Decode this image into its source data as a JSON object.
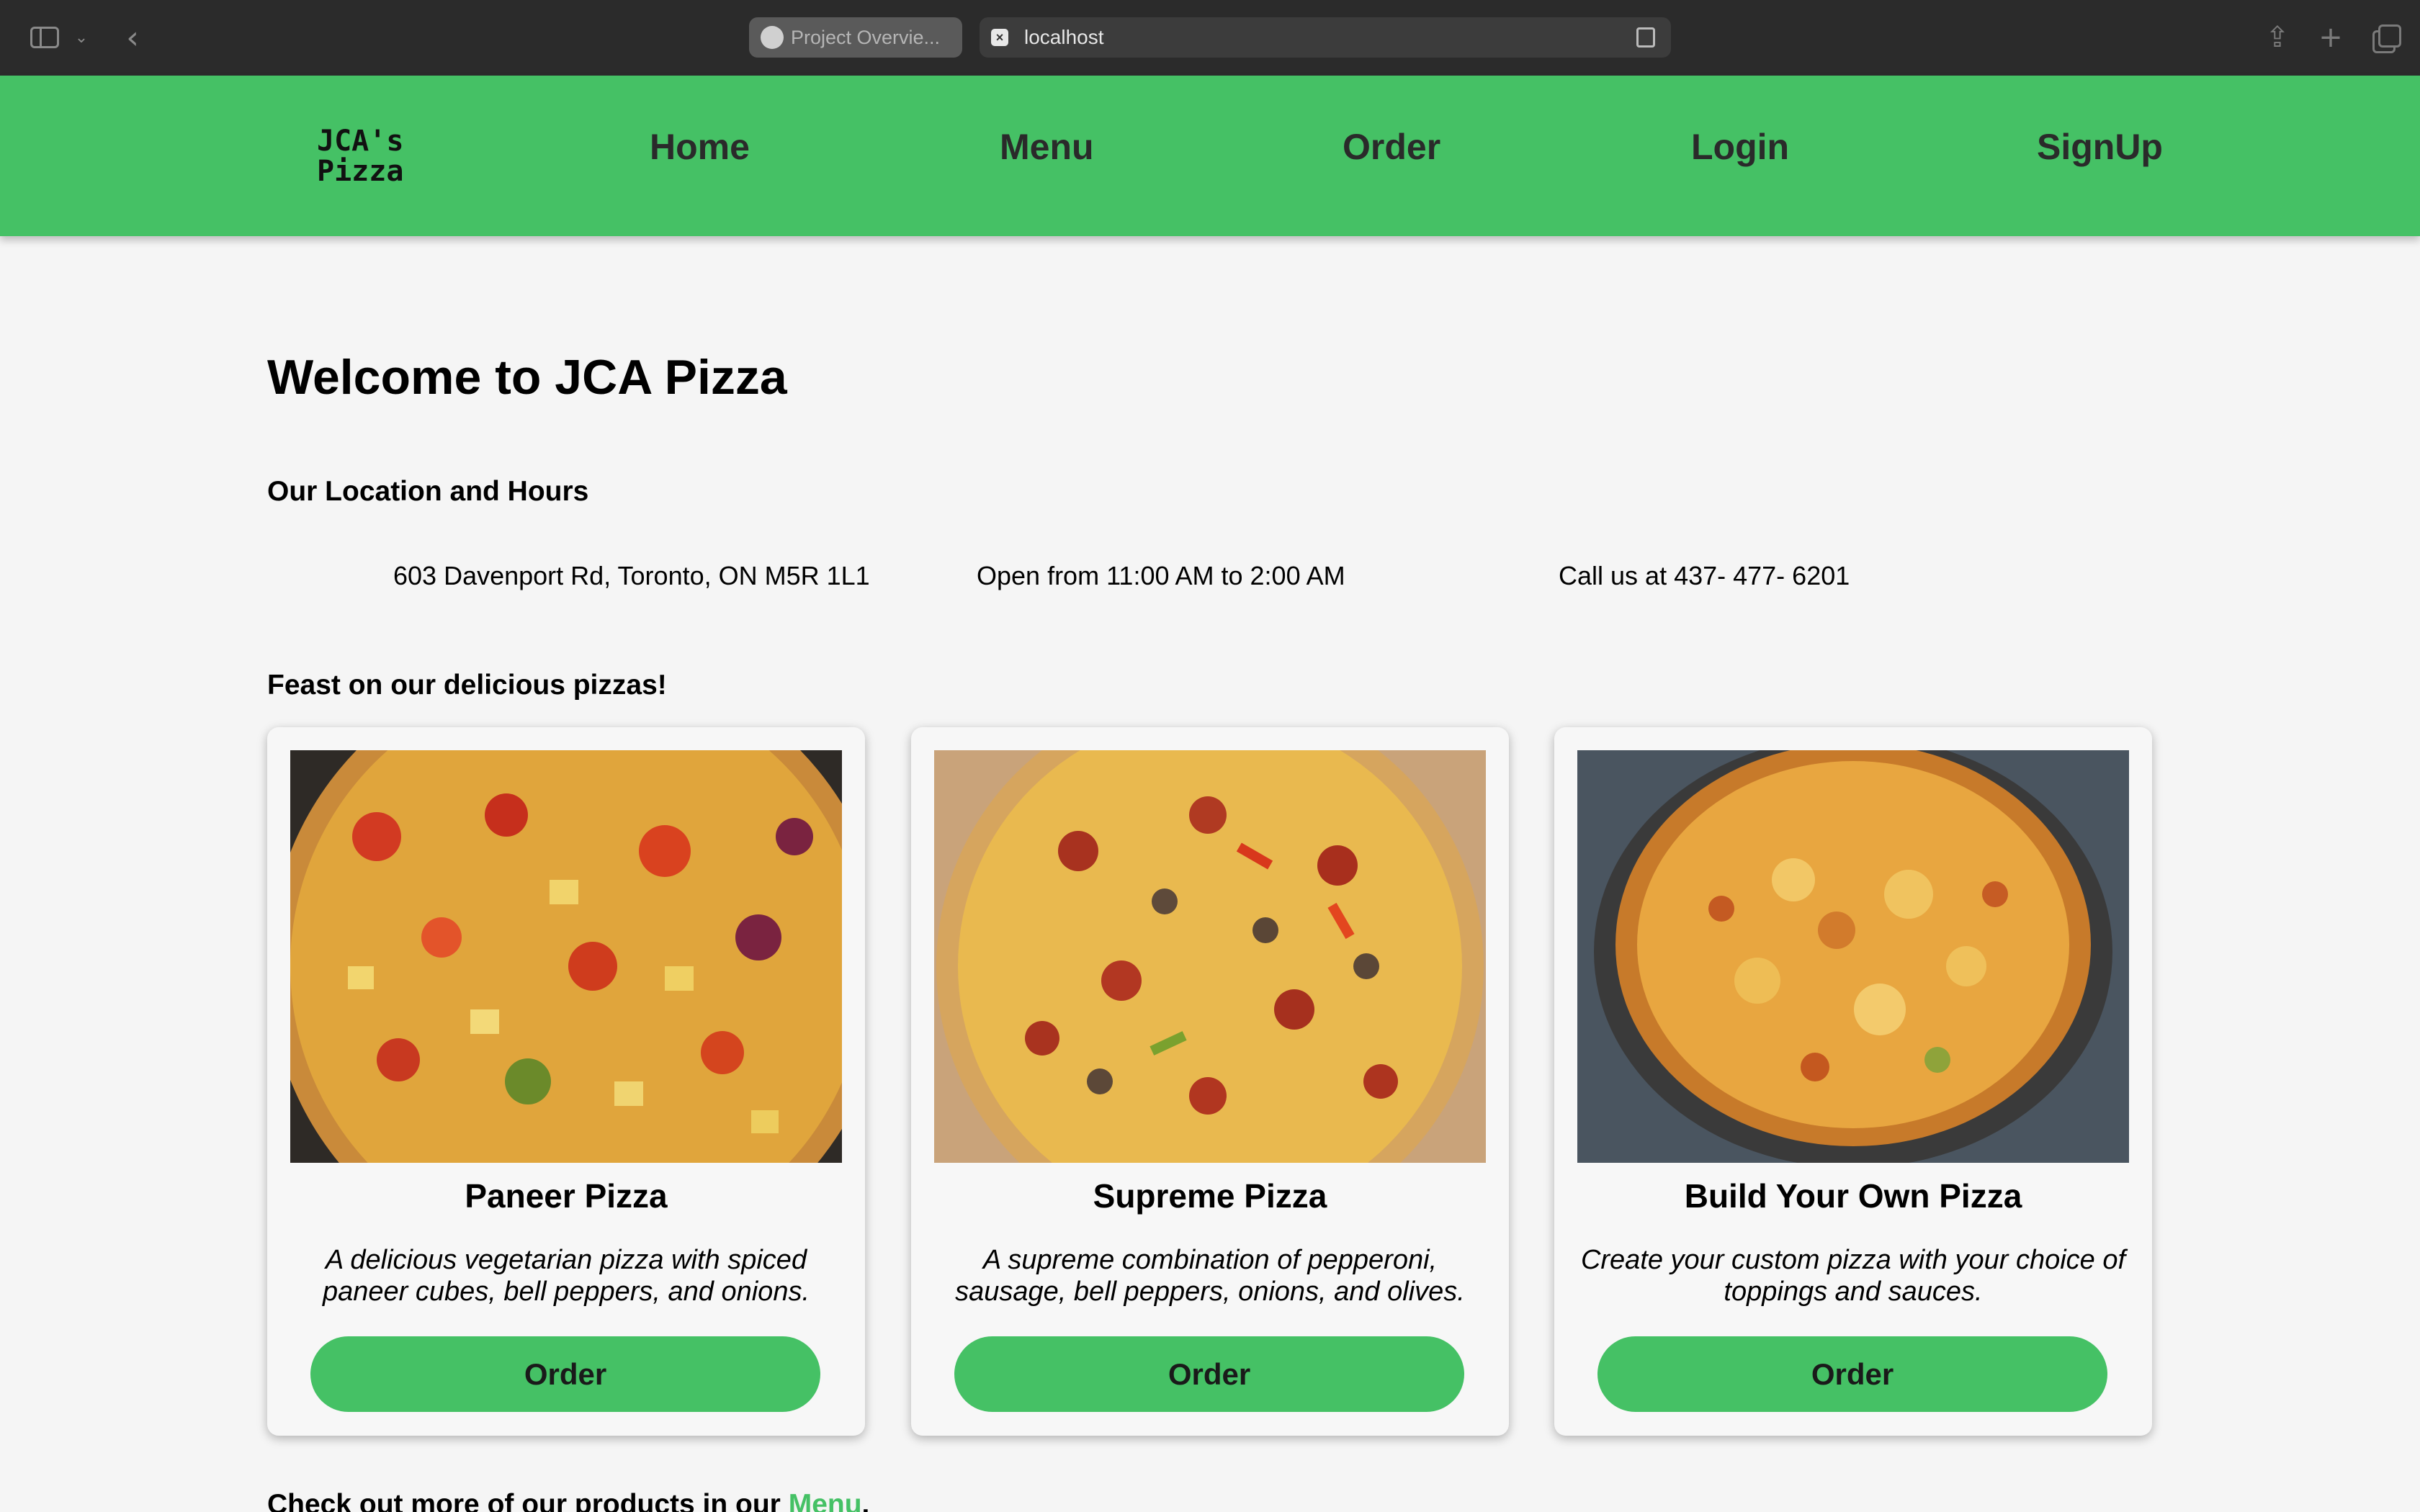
{
  "browser": {
    "inactive_tab_title": "Project Overvie...",
    "active_tab_title": "localhost"
  },
  "site": {
    "logo_line1": "JCA's",
    "logo_line2": "Pizza",
    "nav": {
      "home": "Home",
      "menu": "Menu",
      "order": "Order",
      "login": "Login",
      "signup": "SignUp"
    }
  },
  "main": {
    "title": "Welcome to JCA Pizza",
    "location_heading": "Our Location and Hours",
    "address": "603 Davenport Rd, Toronto, ON M5R 1L1",
    "hours": "Open from 11:00 AM to 2:00 AM",
    "phone": "Call us at 437- 477- 6201",
    "feast_heading": "Feast on our delicious pizzas!",
    "cards": [
      {
        "title": "Paneer Pizza",
        "description": "A delicious vegetarian pizza with spiced paneer cubes, bell peppers, and onions.",
        "button": "Order"
      },
      {
        "title": "Supreme Pizza",
        "description": "A supreme combination of pepperoni, sausage, bell peppers, onions, and olives.",
        "button": "Order"
      },
      {
        "title": "Build Your Own Pizza",
        "description": "Create your custom pizza with your choice of toppings and sauces.",
        "button": "Order"
      }
    ],
    "footer_text": "Check out more of our products in our ",
    "footer_link": "Menu",
    "footer_end": "."
  },
  "colors": {
    "accent_green": "#45c165",
    "chrome_bg": "#2b2b2b",
    "page_bg": "#f5f5f5"
  }
}
